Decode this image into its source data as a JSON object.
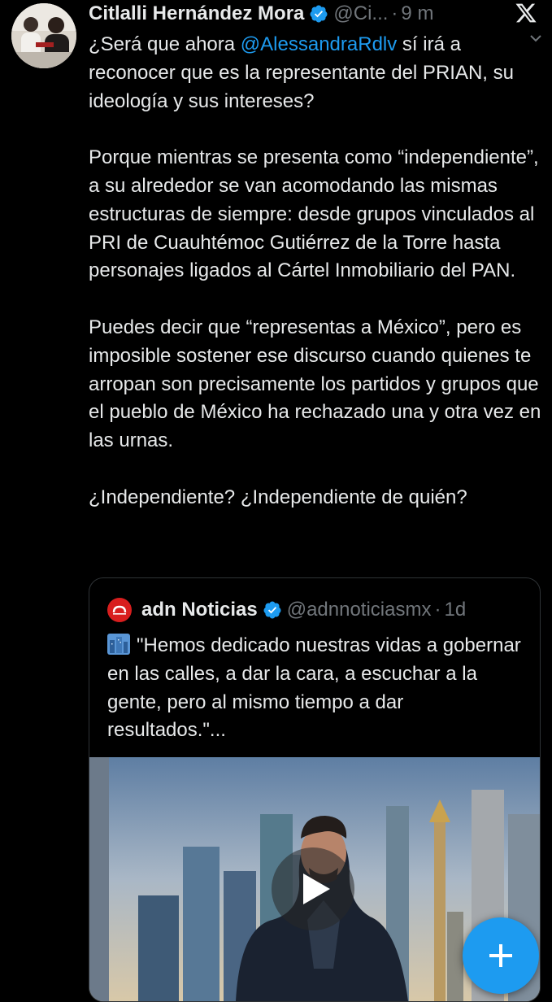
{
  "tweet": {
    "author_name": "Citlalli Hernández Mora",
    "handle": "@Ci...",
    "separator": "·",
    "time": "9 m",
    "paragraph1_before": "¿Será que ahora ",
    "mention": "@AlessandraRdlv",
    "paragraph1_after": " sí irá a reconocer que es la representante del PRIAN, su ideología y sus intereses?",
    "paragraph2": "Porque mientras se presenta como “independiente”, a su alrededor se van acomodando las mismas estructuras de siempre: desde grupos vinculados al PRI de Cuauhtémoc Gutiérrez de la Torre hasta personajes ligados al Cártel Inmobiliario del PAN.",
    "paragraph3": "Puedes decir que “representas a México”, pero es imposible sostener ese discurso cuando quienes te arropan son precisamente los partidos y grupos que el pueblo de México ha rechazado una y otra vez en las urnas.",
    "paragraph4": "¿Independiente? ¿Independiente de quién?"
  },
  "quoted": {
    "author_name": "adn Noticias",
    "handle": "@adnnoticiasmx",
    "separator": "·",
    "time": "1d",
    "text": "\"Hemos dedicado nuestras vidas a gobernar en las calles, a dar la cara, a escuchar a la gente, pero al mismo tiempo a dar resultados.\"..."
  },
  "icons": {
    "verified": "verified-badge-icon",
    "brand": "x-logo-icon",
    "more": "chevron-down-icon",
    "emoji": "cityscape-emoji-icon",
    "play": "play-icon",
    "compose": "plus-icon"
  },
  "colors": {
    "background": "#000000",
    "text": "#e7e9ea",
    "secondary": "#71767b",
    "accent": "#1d9bf0",
    "border": "#2f3336",
    "adn_red": "#d81e1e"
  }
}
